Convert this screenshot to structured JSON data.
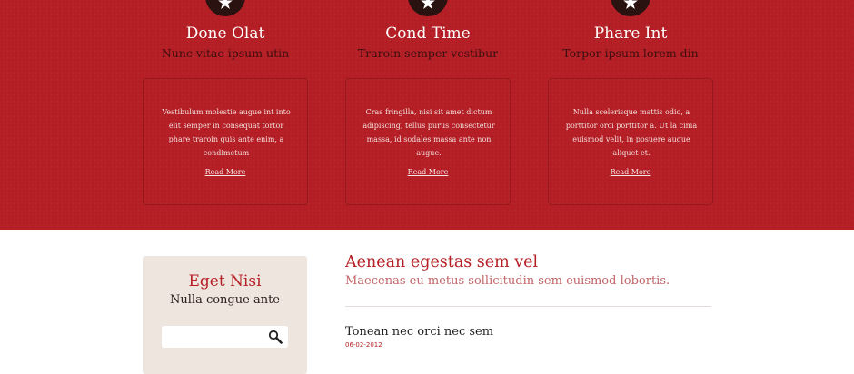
{
  "features": [
    {
      "title": "Done Olat",
      "subtitle": "Nunc vitae ipsum utin",
      "text": "Vestibulum molestie augue int into elit semper in consequat tortor phare traroin quis ante enim, a condimetum",
      "link": "Read More",
      "icon": "star-icon"
    },
    {
      "title": "Cond Time",
      "subtitle": "Traroin semper vestibur",
      "text": "Cras fringilla, nisi sit amet dictum adipiscing, tellus purus consectetur massa, id sodales massa ante non augue.",
      "link": "Read More",
      "icon": "star-icon"
    },
    {
      "title": "Phare Int",
      "subtitle": "Torpor ipsum lorem din",
      "text": "Nulla scelerisque mattis odio, a porttitor orci porttitor a. Ut la cinia euismod velit, in posuere augue aliquet et.",
      "link": "Read More",
      "icon": "star-icon"
    }
  ],
  "sidebar": {
    "title": "Eget Nisi",
    "subtitle": "Nulla congue ante",
    "search_value": "",
    "search_icon": "search-icon"
  },
  "main": {
    "title": "Aenean egestas sem vel",
    "subtitle": "Maecenas eu metus sollicitudin sem euismod lobortis.",
    "posts": [
      {
        "title": "Tonean nec orci nec sem",
        "date": "06-02-2012"
      }
    ]
  },
  "colors": {
    "brand_red": "#b51f25",
    "badge_dark": "#2a1211",
    "sidebar_bg": "#eee5df"
  }
}
